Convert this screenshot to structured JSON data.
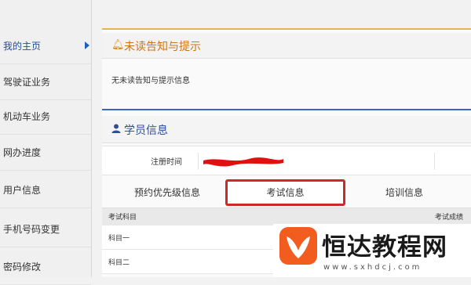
{
  "sidebar": {
    "items": [
      {
        "label": "我的主页"
      },
      {
        "label": "驾驶证业务"
      },
      {
        "label": "机动车业务"
      },
      {
        "label": "网办进度"
      },
      {
        "label": "用户信息"
      },
      {
        "label": "手机号码变更"
      },
      {
        "label": "密码修改"
      }
    ]
  },
  "notice": {
    "title": "未读告知与提示",
    "message": "无未读告知与提示信息",
    "icon": "bell-icon"
  },
  "student": {
    "title": "学员信息",
    "icon": "user-icon",
    "reg_label": "注册时间"
  },
  "tabs": [
    {
      "label": "预约优先级信息"
    },
    {
      "label": "考试信息"
    },
    {
      "label": "培训信息"
    }
  ],
  "table": {
    "headers": [
      "考试科目",
      "考试成绩"
    ],
    "rows": [
      {
        "subject": "科目一"
      },
      {
        "subject": "科目二"
      }
    ]
  },
  "watermark": {
    "title": "恒达教程网",
    "url": "www.sxhdcj.com"
  },
  "colors": {
    "accent_orange": "#c8761a",
    "accent_blue": "#2d4f9a",
    "highlight_red": "#cc2a2a",
    "top_line": "#e6b44a"
  }
}
